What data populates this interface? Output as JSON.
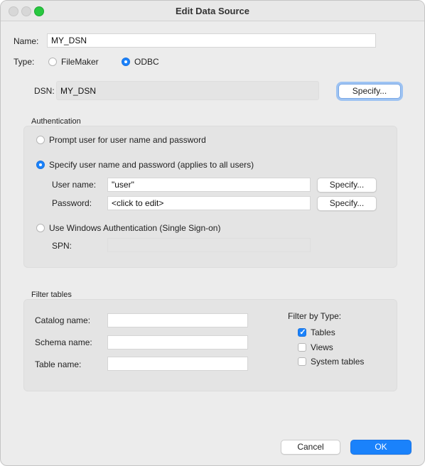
{
  "window": {
    "title": "Edit Data Source"
  },
  "name": {
    "label": "Name:",
    "value": "MY_DSN"
  },
  "type": {
    "label": "Type:",
    "options": [
      {
        "label": "FileMaker",
        "selected": false
      },
      {
        "label": "ODBC",
        "selected": true
      }
    ]
  },
  "dsn": {
    "label": "DSN:",
    "value": "MY_DSN",
    "button": "Specify..."
  },
  "authentication": {
    "title": "Authentication",
    "prompt_label": "Prompt user for user name and password",
    "specify_label": "Specify user name and password (applies to all users)",
    "username_label": "User name:",
    "username_value": "\"user\"",
    "username_button": "Specify...",
    "password_label": "Password:",
    "password_value": "<click to edit>",
    "password_button": "Specify...",
    "windows_label": "Use Windows Authentication (Single Sign-on)",
    "spn_label": "SPN:",
    "spn_value": "",
    "selected": "specify"
  },
  "filter": {
    "title": "Filter tables",
    "catalog_label": "Catalog name:",
    "catalog_value": "",
    "schema_label": "Schema name:",
    "schema_value": "",
    "table_label": "Table name:",
    "table_value": "",
    "by_type_label": "Filter by Type:",
    "types": [
      {
        "label": "Tables",
        "checked": true
      },
      {
        "label": "Views",
        "checked": false
      },
      {
        "label": "System tables",
        "checked": false
      }
    ]
  },
  "buttons": {
    "cancel": "Cancel",
    "ok": "OK"
  },
  "colors": {
    "accent": "#1a82fb",
    "window_bg": "#ececec",
    "group_bg": "#e4e4e4"
  }
}
